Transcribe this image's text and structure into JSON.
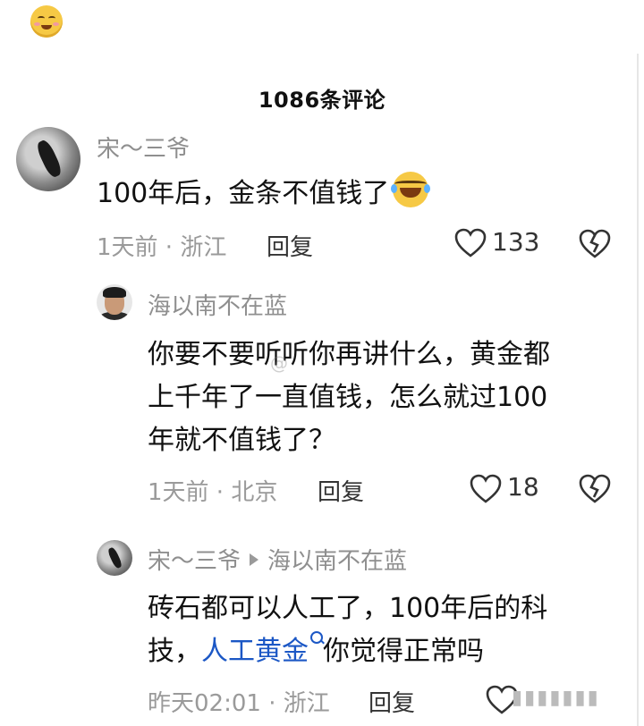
{
  "header": {
    "title": "1086条评论"
  },
  "comments": [
    {
      "username": "宋～三爷",
      "text": "100年后，金条不值钱了",
      "time": "1天前",
      "location": "浙江",
      "reply_label": "回复",
      "likes": "133"
    },
    {
      "username": "海以南不在蓝",
      "text_lines": [
        "你要不要听听你再讲什么，黄金都",
        "上千年了一直值钱，怎么就过100",
        "年就不值钱了？"
      ],
      "time": "1天前",
      "location": "北京",
      "reply_label": "回复",
      "likes": "18"
    },
    {
      "username": "宋～三爷",
      "reply_to": "海以南不在蓝",
      "text_line1": "砖石都可以人工了，100年后的科",
      "text_line2_pre": "技，",
      "link_text": "人工黄金",
      "text_line2_post": "你觉得正常吗",
      "time": "昨天02:01",
      "location": "浙江",
      "reply_label": "回复"
    }
  ],
  "icons": [
    "heart-icon",
    "broken-heart-icon",
    "search-icon",
    "laughing-emoji-icon"
  ]
}
